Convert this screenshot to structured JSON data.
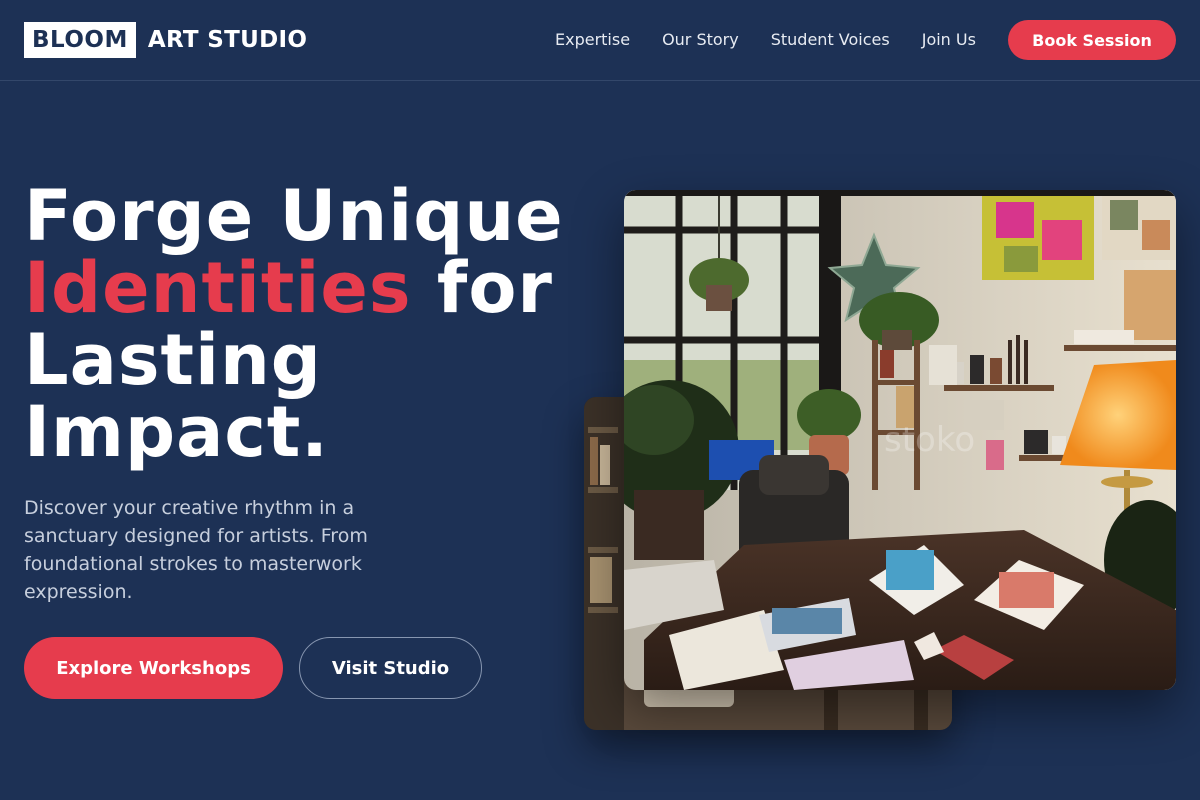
{
  "brand": {
    "logo_box": "BLOOM",
    "logo_text": "ART STUDIO"
  },
  "nav": {
    "items": [
      "Expertise",
      "Our Story",
      "Student Voices",
      "Join Us"
    ],
    "cta": "Book Session"
  },
  "hero": {
    "title_line1": "Forge Unique",
    "title_accent": "Identities",
    "title_rest1": "for",
    "title_line3": "Lasting",
    "title_line4": "Impact.",
    "description": "Discover your creative rhythm in a sanctuary designed for artists. From foundational strokes to masterwork expression.",
    "primary_button": "Explore Workshops",
    "secondary_button": "Visit Studio"
  },
  "colors": {
    "background": "#1d3155",
    "accent": "#e63c4d",
    "text": "#ffffff",
    "muted": "#c7cfdd"
  },
  "images": {
    "main": "art-studio-interior-photo",
    "back": "studio-shelves-photo"
  }
}
